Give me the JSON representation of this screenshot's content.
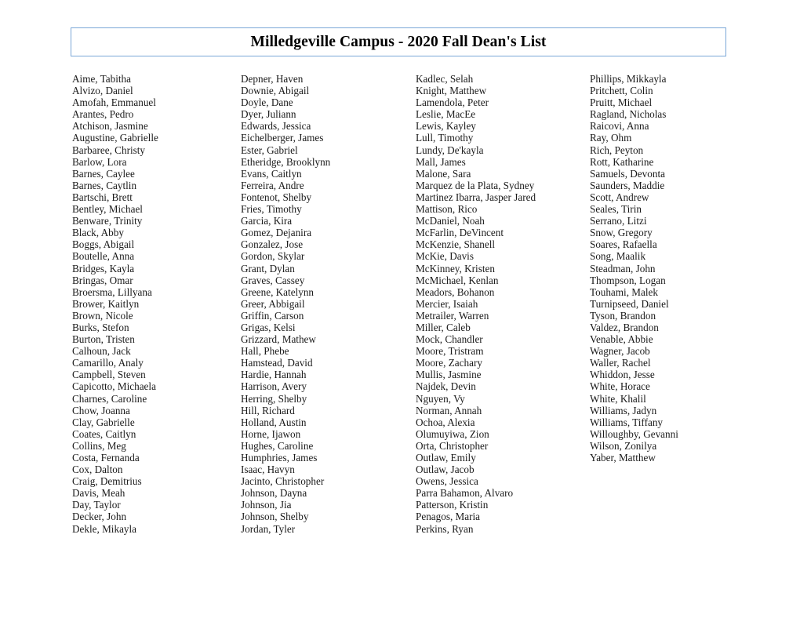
{
  "document": {
    "title": "Milledgeville Campus - 2020 Fall Dean's List"
  },
  "colors": {
    "title_border": "#7ba7d7",
    "text": "#1a1a1a",
    "background": "#ffffff"
  },
  "columns": [
    {
      "names": [
        "Aime, Tabitha",
        "Alvizo, Daniel",
        "Amofah, Emmanuel",
        "Arantes, Pedro",
        "Atchison, Jasmine",
        "Augustine, Gabrielle",
        "Barbaree, Christy",
        "Barlow, Lora",
        "Barnes, Caylee",
        "Barnes, Caytlin",
        "Bartschi, Brett",
        "Bentley, Michael",
        "Benware, Trinity",
        "Black, Abby",
        "Boggs, Abigail",
        "Boutelle, Anna",
        "Bridges, Kayla",
        "Bringas, Omar",
        "Broersma, Lillyana",
        "Brower, Kaitlyn",
        "Brown, Nicole",
        "Burks, Stefon",
        "Burton, Tristen",
        "Calhoun, Jack",
        "Camarillo, Analy",
        "Campbell, Steven",
        "Capicotto, Michaela",
        "Charnes, Caroline",
        "Chow, Joanna",
        "Clay, Gabrielle",
        "Coates, Caitlyn",
        "Collins, Meg",
        "Costa, Fernanda",
        "Cox, Dalton",
        "Craig, Demitrius",
        "Davis, Meah",
        "Day, Taylor",
        "Decker, John",
        "Dekle, Mikayla"
      ]
    },
    {
      "names": [
        "Depner, Haven",
        "Downie, Abigail",
        "Doyle, Dane",
        "Dyer, Juliann",
        "Edwards, Jessica",
        "Eichelberger, James",
        "Ester, Gabriel",
        "Etheridge, Brooklynn",
        "Evans, Caitlyn",
        "Ferreira, Andre",
        "Fontenot, Shelby",
        "Fries, Timothy",
        "Garcia, Kira",
        "Gomez, Dejanira",
        "Gonzalez, Jose",
        "Gordon, Skylar",
        "Grant, Dylan",
        "Graves, Cassey",
        "Greene, Katelynn",
        "Greer, Abbigail",
        "Griffin, Carson",
        "Grigas, Kelsi",
        "Grizzard, Mathew",
        "Hall, Phebe",
        "Hamstead, David",
        "Hardie, Hannah",
        "Harrison, Avery",
        "Herring, Shelby",
        "Hill, Richard",
        "Holland, Austin",
        "Horne, Ijawon",
        "Hughes, Caroline",
        "Humphries, James",
        "Isaac, Havyn",
        "Jacinto, Christopher",
        "Johnson, Dayna",
        "Johnson, Jia",
        "Johnson, Shelby",
        "Jordan, Tyler"
      ]
    },
    {
      "names": [
        "Kadlec, Selah",
        "Knight, Matthew",
        "Lamendola, Peter",
        "Leslie, MacEe",
        "Lewis, Kayley",
        "Lull, Timothy",
        "Lundy, De'kayla",
        "Mall, James",
        "Malone, Sara",
        "Marquez de la Plata, Sydney",
        "Martinez Ibarra, Jasper Jared",
        "Mattison, Rico",
        "McDaniel, Noah",
        "McFarlin, DeVincent",
        "McKenzie, Shanell",
        "McKie, Davis",
        "McKinney, Kristen",
        "McMichael, Kenlan",
        "Meadors, Bohanon",
        "Mercier, Isaiah",
        "Metrailer, Warren",
        "Miller, Caleb",
        "Mock, Chandler",
        "Moore, Tristram",
        "Moore, Zachary",
        "Mullis, Jasmine",
        "Najdek, Devin",
        "Nguyen, Vy",
        "Norman, Annah",
        "Ochoa, Alexia",
        "Olumuyiwa, Zion",
        "Orta, Christopher",
        "Outlaw, Emily",
        "Outlaw, Jacob",
        "Owens, Jessica",
        "Parra Bahamon, Alvaro",
        "Patterson, Kristin",
        "Penagos, Maria",
        "Perkins, Ryan"
      ]
    },
    {
      "names": [
        "Phillips, Mikkayla",
        "Pritchett, Colin",
        "Pruitt, Michael",
        "Ragland, Nicholas",
        "Raicovi, Anna",
        "Ray, Ohm",
        "Rich, Peyton",
        "Rott, Katharine",
        "Samuels, Devonta",
        "Saunders, Maddie",
        "Scott, Andrew",
        "Seales, Tirin",
        "Serrano, Litzi",
        "Snow, Gregory",
        "Soares, Rafaella",
        "Song, Maalik",
        "Steadman, John",
        "Thompson, Logan",
        "Touhami, Malek",
        "Turnipseed, Daniel",
        "Tyson, Brandon",
        "Valdez, Brandon",
        "Venable, Abbie",
        "Wagner, Jacob",
        "Waller, Rachel",
        "Whiddon, Jesse",
        "White, Horace",
        "White, Khalil",
        "Williams, Jadyn",
        "Williams, Tiffany",
        "Willoughby, Gevanni",
        "Wilson, Zonilya",
        "Yaber, Matthew"
      ]
    }
  ]
}
